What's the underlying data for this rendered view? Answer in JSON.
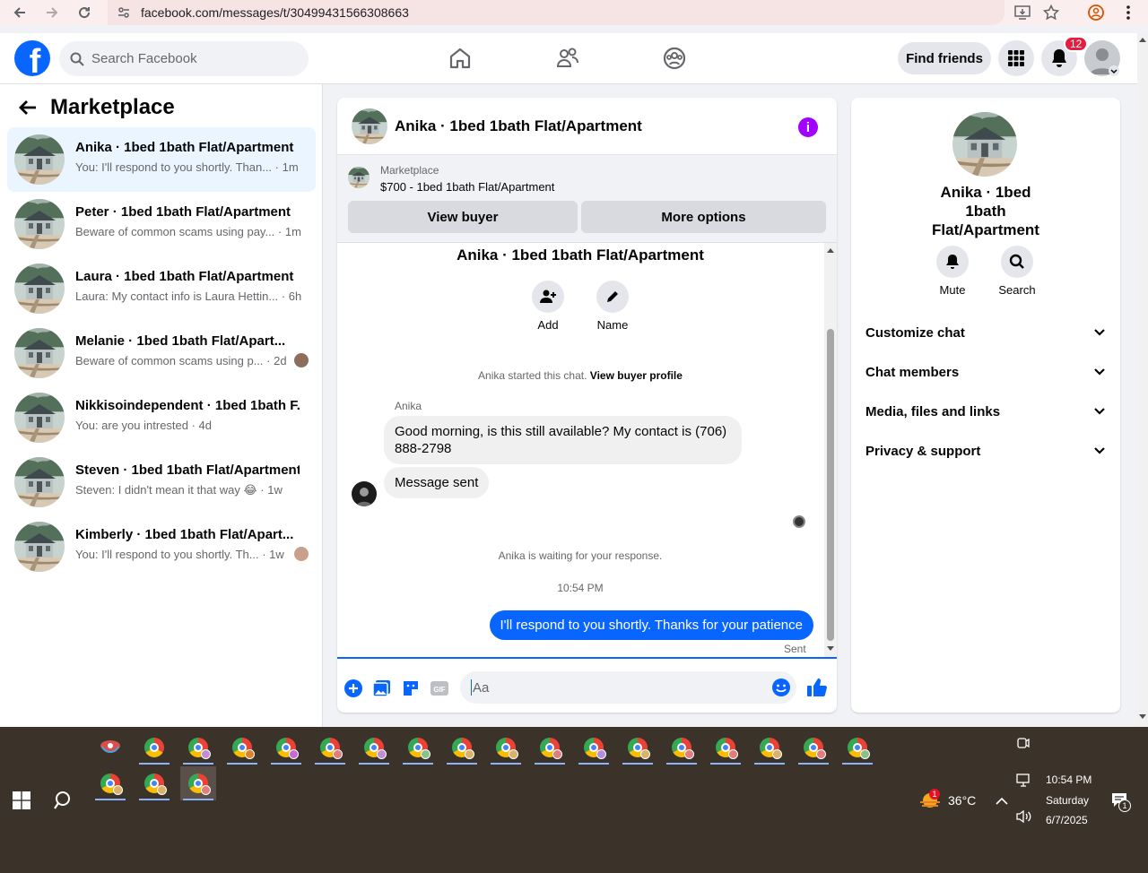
{
  "browser": {
    "url": "facebook.com/messages/t/30499431566308663"
  },
  "header": {
    "search_placeholder": "Search Facebook",
    "find_friends_label": "Find friends",
    "notifications_count": "12"
  },
  "sidebar": {
    "title": "Marketplace",
    "conversations": [
      {
        "name": "Anika · 1bed 1bath Flat/Apartment",
        "preview": "You: I'll respond to you shortly. Than... · 1m",
        "active": true
      },
      {
        "name": "Peter · 1bed 1bath Flat/Apartment",
        "preview": "Beware of common scams using pay... · 1m"
      },
      {
        "name": "Laura · 1bed 1bath Flat/Apartment",
        "preview": "Laura: My contact info is Laura Hettin... · 6h"
      },
      {
        "name": "Melanie · 1bed 1bath Flat/Apart...",
        "preview": "Beware of common scams using p... · 2d"
      },
      {
        "name": "Nikkisoindependent · 1bed 1bath F...",
        "preview": "You: are you intrested · 4d"
      },
      {
        "name": "Steven · 1bed 1bath Flat/Apartment",
        "preview": "Steven: I didn't mean it that way 😂 · 1w"
      },
      {
        "name": "Kimberly · 1bed 1bath Flat/Apart...",
        "preview": "You: I'll respond to you shortly. Th... · 1w"
      }
    ]
  },
  "chat": {
    "title": "Anika · 1bed 1bath Flat/Apartment",
    "listing": {
      "label": "Marketplace",
      "title": "$700 - 1bed 1bath Flat/Apartment",
      "view_buyer": "View buyer",
      "more_options": "More options"
    },
    "intro_title": "Anika · 1bed 1bath Flat/Apartment",
    "actions": {
      "add": "Add",
      "name": "Name"
    },
    "started_text": "Anika started this chat.",
    "view_profile": "View buyer profile",
    "sender": "Anika",
    "incoming_1_line1": "Good morning, is this still available? My contact is (706)",
    "incoming_1_line2": "888-2798",
    "incoming_2": "Message sent",
    "waiting": "Anika is waiting for your response.",
    "timestamp": "10:54 PM",
    "outgoing": "I'll respond to you shortly. Thanks for your patience",
    "sent_status": "Sent",
    "composer_placeholder": "Aa"
  },
  "info_panel": {
    "name": "Anika · 1bed 1bath Flat/Apartment",
    "mute": "Mute",
    "search": "Search",
    "rows": [
      "Customize chat",
      "Chat members",
      "Media, files and links",
      "Privacy & support"
    ]
  },
  "taskbar": {
    "weather_temp": "36°C",
    "weather_badge": "1",
    "time": "10:54 PM",
    "day": "Saturday",
    "date": "6/7/2025",
    "notification_count": "1"
  },
  "colors": {
    "brand_blue": "#0866ff",
    "info_purple": "#a200ff",
    "badge_red": "#e41e3f"
  }
}
